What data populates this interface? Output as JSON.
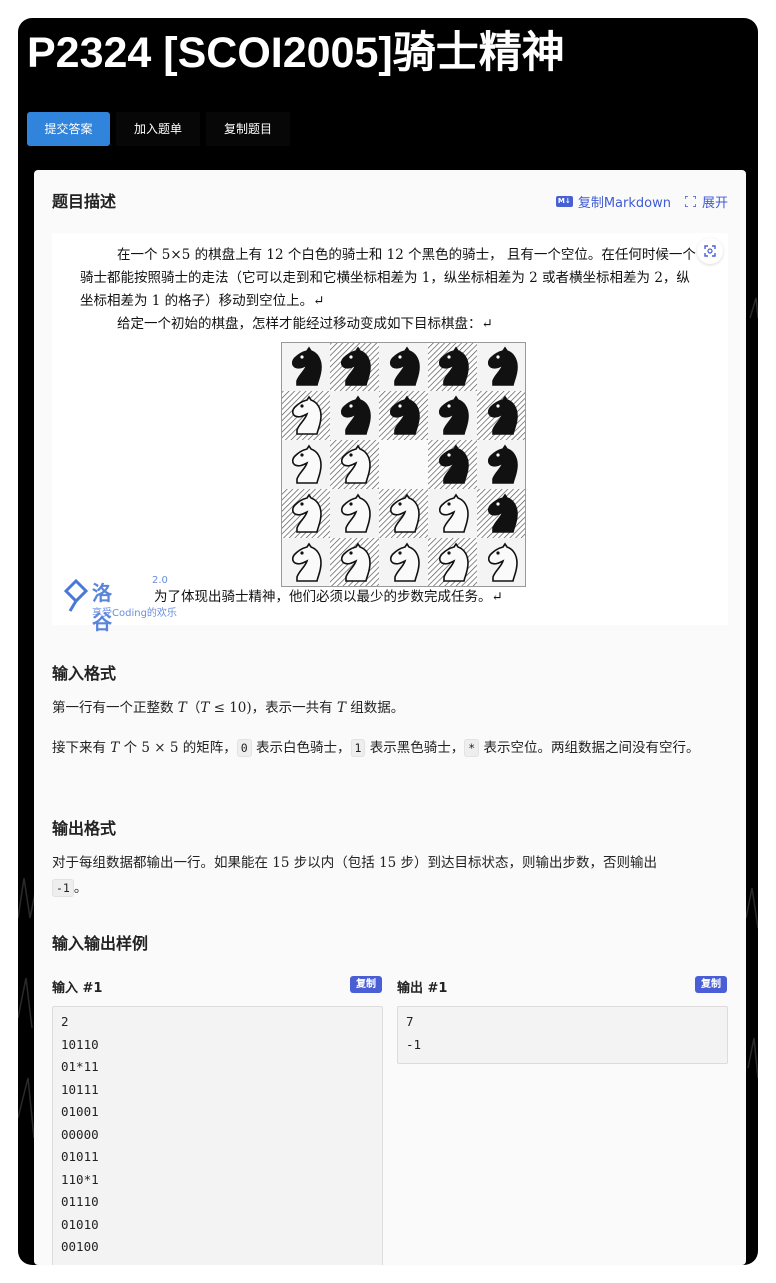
{
  "problem": {
    "title": "P2324 [SCOI2005]骑士精神"
  },
  "actions": {
    "submit": "提交答案",
    "add_list": "加入题单",
    "copy_problem": "复制题目"
  },
  "description": {
    "heading": "题目描述",
    "copy_markdown": "复制Markdown",
    "expand": "展开",
    "para1": "在一个 5×5 的棋盘上有 12 个白色的骑士和 12 个黑色的骑士， 且有一个空位。在任何时候一个骑士都能按照骑士的走法（它可以走到和它横坐标相差为 1，纵坐标相差为 2 或者横坐标相差为 2，纵坐标相差为 1 的格子）移动到空位上。↵",
    "para2": "给定一个初始的棋盘，怎样才能经过移动变成如下目标棋盘：↵",
    "para3": "为了体现出骑士精神，他们必须以最少的步数完成任务。↵",
    "target_board": [
      [
        "black",
        "black",
        "black",
        "black",
        "black"
      ],
      [
        "white",
        "black",
        "black",
        "black",
        "black"
      ],
      [
        "white",
        "white",
        "empty",
        "black",
        "black"
      ],
      [
        "white",
        "white",
        "white",
        "white",
        "black"
      ],
      [
        "white",
        "white",
        "white",
        "white",
        "white"
      ]
    ],
    "watermark": {
      "brand": "洛谷",
      "version": "2.0",
      "slogan": "享受Coding的欢乐"
    }
  },
  "input_format": {
    "heading": "输入格式",
    "line1": {
      "a": "第一行有一个正整数 ",
      "T": "T",
      "b": "（",
      "T2": "T",
      "c": " ≤ 10)，表示一共有 ",
      "T3": "T",
      "d": " 组数据。"
    },
    "line2": {
      "a": "接下来有 ",
      "T": "T",
      "b": " 个 ",
      "dims": "5 × 5",
      "c": " 的矩阵，",
      "code0": "0",
      "d": " 表示白色骑士，",
      "code1": "1",
      "e": " 表示黑色骑士，",
      "codestar": "*",
      "f": " 表示空位。两组数据之间没有空行。"
    }
  },
  "output_format": {
    "heading": "输出格式",
    "a": "对于每组数据都输出一行。如果能在 ",
    "n1": "15",
    "b": " 步以内（包括 ",
    "n2": "15",
    "c": " 步）到达目标状态，则输出步数，否则输出",
    "code": "-1",
    "d": "。"
  },
  "samples": {
    "heading": "输入输出样例",
    "input_label": "输入 #1",
    "output_label": "输出 #1",
    "copy": "复制",
    "input_lines": [
      "2",
      "10110",
      "01*11",
      "10111",
      "01001",
      "00000",
      "01011",
      "110*1",
      "01110",
      "01010",
      "00100"
    ],
    "output_lines": [
      "7",
      "-1"
    ]
  }
}
